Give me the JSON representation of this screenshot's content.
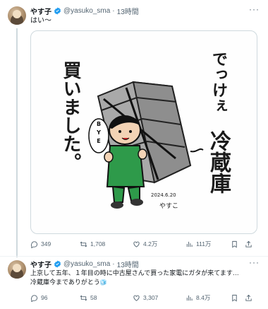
{
  "tweets": [
    {
      "name": "やす子",
      "handle": "@yasuko_sma",
      "time": "13時間",
      "text": "はい〜",
      "media": {
        "left_text": "買いました。",
        "right_text_1": "でっけぇ",
        "right_text_2": "冷蔵庫",
        "bubble": "BYE",
        "signature_date": "2024.6.20",
        "signature_name": "やすこ"
      },
      "actions": {
        "replies": "349",
        "reposts": "1,708",
        "likes": "4.2万",
        "views": "111万"
      }
    },
    {
      "name": "やす子",
      "handle": "@yasuko_sma",
      "time": "13時間",
      "text_line1": "上京して五年、１年目の時に中古屋さんで買った家電にガタが来てます…",
      "text_line2": "冷蔵庫今までありがとう",
      "emoji": "🧊",
      "actions": {
        "replies": "96",
        "reposts": "58",
        "likes": "3,307",
        "views": "8.4万"
      }
    }
  ],
  "colors": {
    "verified": "#1d9bf0",
    "muted": "#536471",
    "border": "#cfd9de",
    "shirt": "#2e9a4a"
  }
}
